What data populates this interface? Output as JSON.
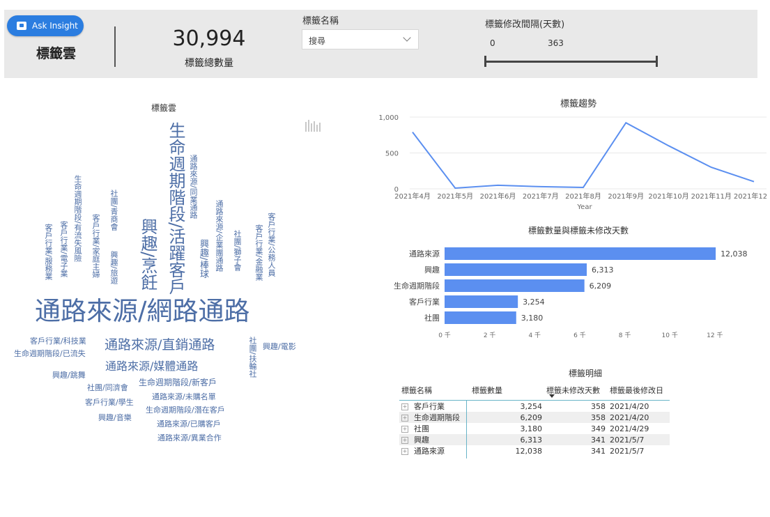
{
  "header": {
    "ask_insight_label": "Ask Insight",
    "page_title": "標籤雲",
    "kpi_value": "30,994",
    "kpi_label": "標籤總數量",
    "filter_name_title": "標籤名稱",
    "filter_name_value": "搜尋",
    "slider_title": "標籤修改間隔(天數)",
    "slider_min": "0",
    "slider_max": "363"
  },
  "wordcloud": {
    "title": "標籤雲",
    "words": [
      "通路來源/網路通路",
      "生命週期階段/活躍客戶",
      "興趣/烹飪",
      "通路來源/直銷通路",
      "通路來源/媒體通路",
      "客戶行業/科技業",
      "生命週期階段/已流失",
      "興趣/電影",
      "社團/扶輪社",
      "興趣/跳舞",
      "社團/同濟會",
      "生命週期階段/新客戶",
      "通路來源/未購名單",
      "客戶行業/學生",
      "生命週期階段/潛在客戶",
      "興趣/音樂",
      "通路來源/已購客戶",
      "通路來源/異業合作",
      "通路來源/同業通路",
      "興趣/棒球",
      "通路來源/企業團通路",
      "社團/獅子會",
      "客戶行業/公務人員",
      "客戶行業/金融業",
      "生命週期階段/有流失風險",
      "客戶行業/家庭主婦",
      "社團/青商會",
      "興趣/旅遊",
      "客戶行業/服務業",
      "客戶行業/電子業"
    ]
  },
  "trend": {
    "title": "標籤趨勢",
    "xlabel": "Year"
  },
  "barchart": {
    "title": "標籤數量與標籤未修改天數"
  },
  "chart_data": [
    {
      "type": "line",
      "title": "標籤趨勢",
      "xlabel": "Year",
      "ylabel": "",
      "x": [
        "2021年4月",
        "2021年5月",
        "2021年6月",
        "2021年7月",
        "2021年8月",
        "2021年9月",
        "2021年10月",
        "2021年11月",
        "2021年12月"
      ],
      "values": [
        790,
        10,
        50,
        30,
        20,
        920,
        600,
        300,
        100
      ],
      "ylim": [
        0,
        1000
      ],
      "yticks": [
        "0",
        "500",
        "1,000"
      ],
      "grid": true,
      "color": "#5b8ff0"
    },
    {
      "type": "bar",
      "orientation": "horizontal",
      "title": "標籤數量與標籤未修改天數",
      "categories": [
        "通路來源",
        "興趣",
        "生命週期階段",
        "客戶行業",
        "社團"
      ],
      "values": [
        12038,
        6313,
        6209,
        3254,
        3180
      ],
      "value_labels": [
        "12,038",
        "6,313",
        "6,209",
        "3,254",
        "3,180"
      ],
      "xlim": [
        0,
        12500
      ],
      "xticks": [
        "0 千",
        "2 千",
        "4 千",
        "6 千",
        "8 千",
        "10 千",
        "12 千"
      ],
      "color": "#5b8ff0"
    }
  ],
  "matrix": {
    "title": "標籤明細",
    "headers": [
      "標籤名稱",
      "標籤數量",
      "標籤未修改天數",
      "標籤最後修改日"
    ],
    "rows": [
      {
        "name": "客戶行業",
        "count": "3,254",
        "days": "358",
        "date": "2021/4/20"
      },
      {
        "name": "生命週期階段",
        "count": "6,209",
        "days": "358",
        "date": "2021/4/20"
      },
      {
        "name": "社團",
        "count": "3,180",
        "days": "349",
        "date": "2021/4/29"
      },
      {
        "name": "興趣",
        "count": "6,313",
        "days": "341",
        "date": "2021/5/7"
      },
      {
        "name": "通路來源",
        "count": "12,038",
        "days": "341",
        "date": "2021/5/7"
      }
    ],
    "expand_symbol": "+"
  },
  "colors": {
    "accent": "#2b7de0",
    "chart": "#5b8ff0",
    "cloud": "#4d6ea6",
    "header_bg": "#e9e9e9"
  }
}
